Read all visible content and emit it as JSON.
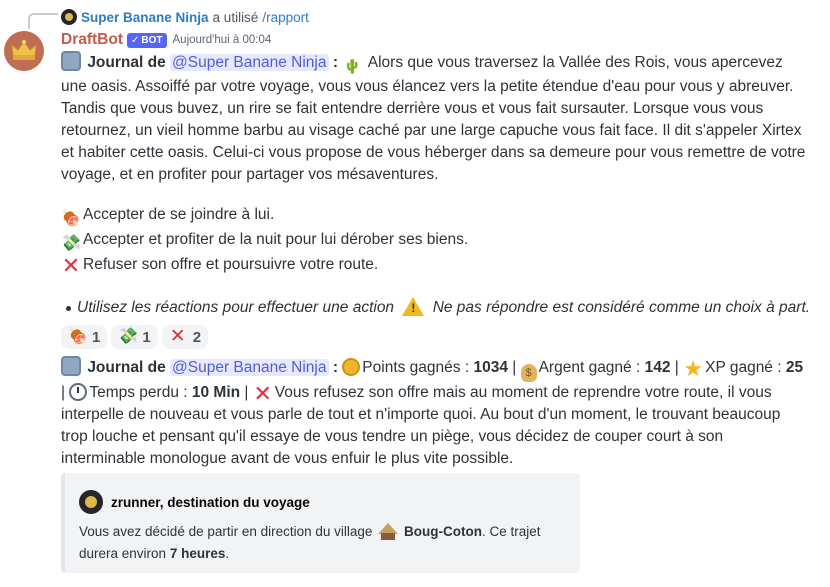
{
  "reply": {
    "user": "Super Banane Ninja",
    "text": "a utilisé",
    "command": "/rapport"
  },
  "message": {
    "username": "DraftBot",
    "bot_tag": "BOT",
    "timestamp": "Aujourd'hui à 00:04",
    "mention": "@Super Banane Ninja",
    "journal_label": "Journal de",
    "intro": "Alors que vous traversez la Vallée des Rois, vous apercevez une oasis. Assoiffé par votre voyage, vous vous élancez vers la petite étendue d'eau pour vous y abreuver. Tandis que vous buvez, un rire se fait entendre derrière vous et vous fait sursauter. Lorsque vous vous retournez, un vieil homme barbu au visage caché par une large capuche vous fait face. Il dit s'appeler Xirtex et habiter cette oasis. Celui-ci vous propose de vous héberger dans sa demeure pour vous remettre de votre voyage, et en profiter pour partager vos mésaventures.",
    "choices": [
      {
        "icon": "meat-icon",
        "label": "Accepter de se joindre à lui."
      },
      {
        "icon": "money-with-wings-icon",
        "label": "Accepter et profiter de la nuit pour lui dérober ses biens."
      },
      {
        "icon": "cross-mark-icon",
        "label": "Refuser son offre et poursuivre votre route."
      }
    ],
    "hint_a": "Utilisez les réactions pour effectuer une action",
    "hint_b": "Ne pas répondre est considéré comme un choix à part."
  },
  "reactions": [
    {
      "icon": "meat-icon",
      "count": "1"
    },
    {
      "icon": "money-with-wings-icon",
      "count": "1"
    },
    {
      "icon": "cross-mark-icon",
      "count": "2"
    }
  ],
  "result": {
    "journal_label": "Journal de",
    "mention": "@Super Banane Ninja",
    "points_label": "Points gagnés :",
    "points_value": "1034",
    "money_label": "Argent gagné :",
    "money_value": "142",
    "xp_label": "XP gagné :",
    "xp_value": "25",
    "time_label": "Temps perdu :",
    "time_value": "10 Min",
    "text": "Vous refusez son offre mais au moment de reprendre votre route, il vous interpelle de nouveau et vous parle de tout et n'importe quoi. Au bout d'un moment, le trouvant beaucoup trop louche et pensant qu'il essaye de vous tendre un piège, vous décidez de couper court à son interminable monologue avant de vous enfuir le plus vite possible."
  },
  "embed": {
    "author": "zrunner, destination du voyage",
    "desc_a": "Vous avez décidé de partir en direction du village",
    "village": "Boug-Coton",
    "desc_b": ". Ce trajet durera environ",
    "duration": "7 heures",
    "desc_end": "."
  }
}
